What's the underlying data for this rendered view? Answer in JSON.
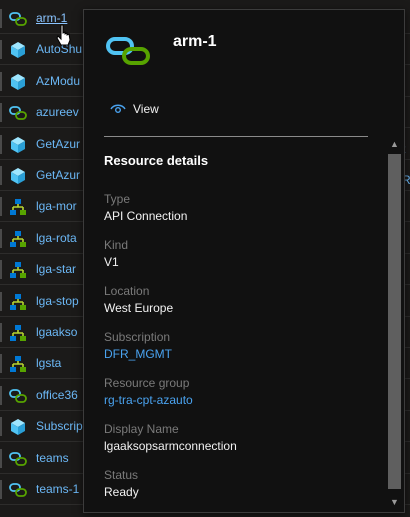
{
  "list": {
    "items": [
      {
        "label": "arm-1",
        "icon": "api-connection-icon"
      },
      {
        "label": "AutoShu",
        "icon": "cube-icon"
      },
      {
        "label": "AzModu",
        "icon": "cube-icon"
      },
      {
        "label": "azureev",
        "icon": "api-connection-icon"
      },
      {
        "label": "GetAzur",
        "icon": "cube-icon"
      },
      {
        "label": "GetAzur",
        "icon": "cube-icon"
      },
      {
        "label": "lga-mor",
        "icon": "logic-app-icon"
      },
      {
        "label": "lga-rota",
        "icon": "logic-app-icon"
      },
      {
        "label": "lga-star",
        "icon": "logic-app-icon"
      },
      {
        "label": "lga-stop",
        "icon": "logic-app-icon"
      },
      {
        "label": "lgaakso",
        "icon": "logic-app-icon"
      },
      {
        "label": "lgsta",
        "icon": "logic-app-icon"
      },
      {
        "label": "office36",
        "icon": "api-connection-icon"
      },
      {
        "label": "Subscrip",
        "icon": "cube-icon"
      },
      {
        "label": "teams",
        "icon": "api-connection-icon"
      },
      {
        "label": "teams-1",
        "icon": "api-connection-icon"
      }
    ],
    "right_fragments": [
      "t",
      "R"
    ]
  },
  "card": {
    "title": "arm-1",
    "view_label": "View",
    "section_title": "Resource details",
    "fields": [
      {
        "label": "Type",
        "value": "API Connection",
        "link": false
      },
      {
        "label": "Kind",
        "value": "V1",
        "link": false
      },
      {
        "label": "Location",
        "value": "West Europe",
        "link": false
      },
      {
        "label": "Subscription",
        "value": "DFR_MGMT",
        "link": true
      },
      {
        "label": "Resource group",
        "value": "rg-tra-cpt-azauto",
        "link": true
      },
      {
        "label": "Display Name",
        "value": "lgaaksopsarmconnection",
        "link": false
      },
      {
        "label": "Status",
        "value": "Ready",
        "link": false
      }
    ]
  },
  "colors": {
    "link": "#4aa3f0",
    "icon_green": "#57a300",
    "icon_blue": "#0078d4",
    "cube_blue": "#50c3f3"
  }
}
